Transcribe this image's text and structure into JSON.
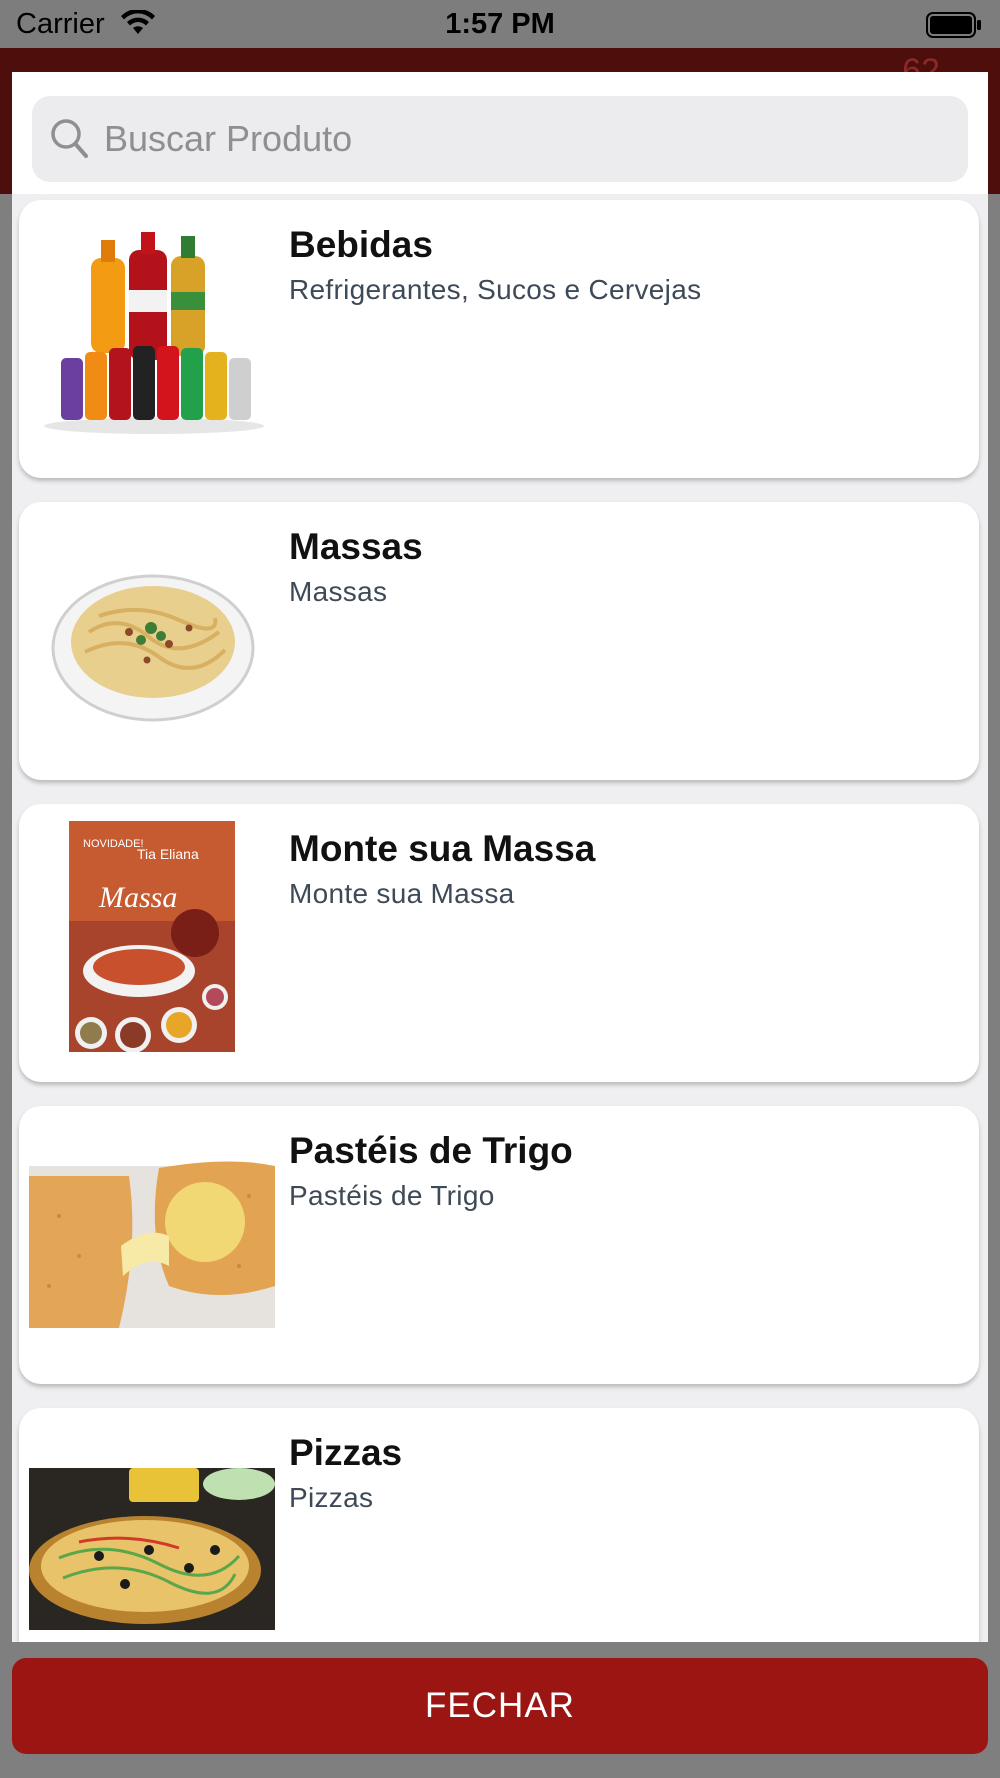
{
  "status_bar": {
    "carrier": "Carrier",
    "time": "1:57 PM",
    "wifi_icon": "wifi-icon",
    "battery_icon": "battery-full-icon"
  },
  "background": {
    "badge_count": "62",
    "header_color": "#4e0e0c"
  },
  "search": {
    "placeholder": "Buscar Produto",
    "value": "",
    "icon": "search-icon"
  },
  "categories": [
    {
      "title": "Bebidas",
      "subtitle": "Refrigerantes, Sucos e Cervejas",
      "image": "drinks-bottles-image"
    },
    {
      "title": "Massas",
      "subtitle": "Massas",
      "image": "pasta-dish-image"
    },
    {
      "title": "Monte sua Massa",
      "subtitle": "Monte sua Massa",
      "image": "monte-sua-massa-poster-image"
    },
    {
      "title": "Pastéis de Trigo",
      "subtitle": "Pastéis de Trigo",
      "image": "pastel-cheese-image"
    },
    {
      "title": "Pizzas",
      "subtitle": "Pizzas",
      "image": "pizza-image"
    }
  ],
  "close_button": {
    "label": "FECHAR"
  },
  "colors": {
    "accent": "#9b1612",
    "overlay": "#7d7d7d",
    "card_bg": "#ffffff",
    "list_bg": "#efeff1"
  }
}
